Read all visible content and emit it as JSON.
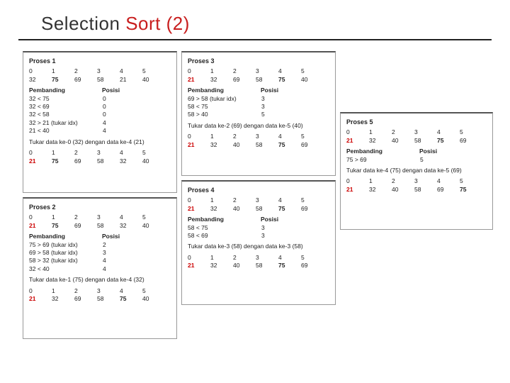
{
  "title_pre": "Selection ",
  "title_accent": "Sort (2)",
  "labels": {
    "pembanding": "Pembanding",
    "posisi": "Posisi"
  },
  "panels": [
    {
      "name": "Proses 1",
      "idx": [
        "0",
        "1",
        "2",
        "3",
        "4",
        "5"
      ],
      "vals": [
        "32",
        "75",
        "69",
        "58",
        "21",
        "40"
      ],
      "comps": [
        {
          "l": "32 < 75",
          "r": "0"
        },
        {
          "l": "32 < 69",
          "r": "0"
        },
        {
          "l": "32 < 58",
          "r": "0"
        },
        {
          "l": "32 > 21 (tukar idx)",
          "r": "4"
        },
        {
          "l": "21 < 40",
          "r": "4"
        }
      ],
      "swap": "Tukar data ke-0 (32) dengan data ke-4 (21)",
      "res_idx": [
        "0",
        "1",
        "2",
        "3",
        "4",
        "5"
      ],
      "res_vals": [
        "21",
        "75",
        "69",
        "58",
        "32",
        "40"
      ]
    },
    {
      "name": "Proses 2",
      "idx": [
        "0",
        "1",
        "2",
        "3",
        "4",
        "5"
      ],
      "vals": [
        "21",
        "75",
        "69",
        "58",
        "32",
        "40"
      ],
      "comps": [
        {
          "l": "75 > 69 (tukar idx)",
          "r": "2"
        },
        {
          "l": "69 > 58 (tukar idx)",
          "r": "3"
        },
        {
          "l": "58 > 32 (tukar idx)",
          "r": "4"
        },
        {
          "l": "32 < 40",
          "r": "4"
        }
      ],
      "swap": "Tukar data ke-1 (75) dengan data ke-4 (32)",
      "res_idx": [
        "0",
        "1",
        "2",
        "3",
        "4",
        "5"
      ],
      "res_vals": [
        "21",
        "32",
        "69",
        "58",
        "75",
        "40"
      ]
    },
    {
      "name": "Proses 3",
      "idx": [
        "0",
        "1",
        "2",
        "3",
        "4",
        "5"
      ],
      "vals": [
        "21",
        "32",
        "69",
        "58",
        "75",
        "40"
      ],
      "comps": [
        {
          "l": "69 > 58 (tukar idx)",
          "r": "3"
        },
        {
          "l": "58 < 75",
          "r": "3"
        },
        {
          "l": "58 > 40",
          "r": "5"
        }
      ],
      "swap": "Tukar data ke-2 (69) dengan data ke-5 (40)",
      "res_idx": [
        "0",
        "1",
        "2",
        "3",
        "4",
        "5"
      ],
      "res_vals": [
        "21",
        "32",
        "40",
        "58",
        "75",
        "69"
      ]
    },
    {
      "name": "Proses 4",
      "idx": [
        "0",
        "1",
        "2",
        "3",
        "4",
        "5"
      ],
      "vals": [
        "21",
        "32",
        "40",
        "58",
        "75",
        "69"
      ],
      "comps": [
        {
          "l": "58 < 75",
          "r": "3"
        },
        {
          "l": "58 < 69",
          "r": "3"
        }
      ],
      "swap": "Tukar data ke-3 (58) dengan data ke-3 (58)",
      "res_idx": [
        "0",
        "1",
        "2",
        "3",
        "4",
        "5"
      ],
      "res_vals": [
        "21",
        "32",
        "40",
        "58",
        "75",
        "69"
      ]
    },
    {
      "name": "Proses 5",
      "idx": [
        "0",
        "1",
        "2",
        "3",
        "4",
        "5"
      ],
      "vals": [
        "21",
        "32",
        "40",
        "58",
        "75",
        "69"
      ],
      "comps": [
        {
          "l": "75 > 69",
          "r": "5"
        }
      ],
      "swap": "Tukar data ke-4 (75) dengan data ke-5 (69)",
      "res_idx": [
        "0",
        "1",
        "2",
        "3",
        "4",
        "5"
      ],
      "res_vals": [
        "21",
        "32",
        "40",
        "58",
        "69",
        "75"
      ]
    }
  ]
}
